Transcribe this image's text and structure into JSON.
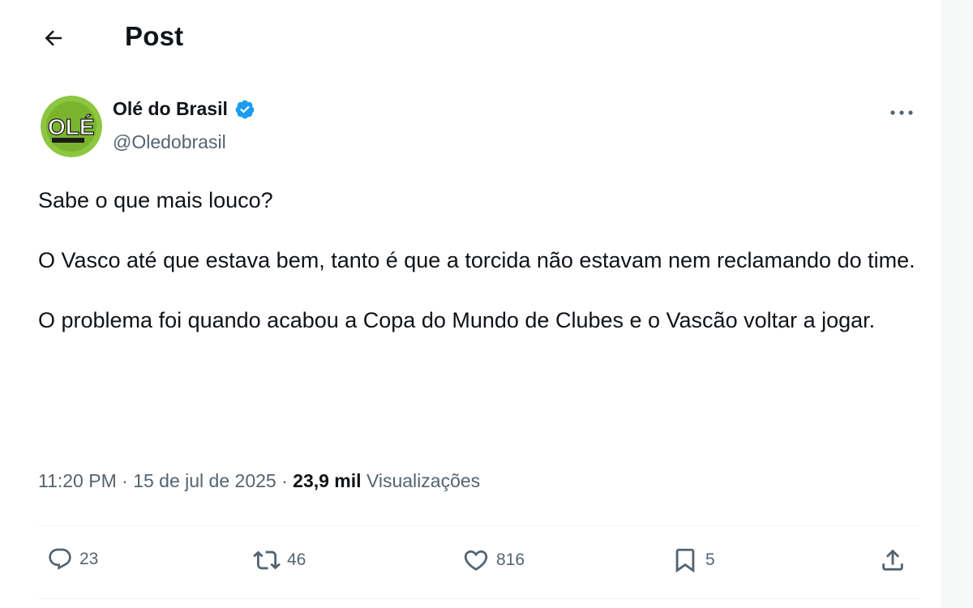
{
  "header": {
    "title": "Post"
  },
  "author": {
    "name": "Olé do Brasil",
    "handle": "@Oledobrasil",
    "avatar_text": "OLÉ"
  },
  "tweet": {
    "paragraphs": [
      "Sabe o que mais louco?",
      "O Vasco até que estava bem, tanto é que a torcida não estavam nem reclamando do time.",
      "O problema foi quando acabou a Copa do Mundo de Clubes e o Vascão voltar a jogar."
    ],
    "time": "11:20 PM",
    "separator": " · ",
    "date": "15 de jul de 2025",
    "views_count": "23,9 mil",
    "views_label": "Visualizações"
  },
  "actions": {
    "replies": "23",
    "reposts": "46",
    "likes": "816",
    "bookmarks": "5"
  },
  "colors": {
    "verified_blue": "#1d9bf0",
    "text_primary": "#0f1419",
    "text_secondary": "#536471",
    "avatar_green": "#8dc63f"
  }
}
